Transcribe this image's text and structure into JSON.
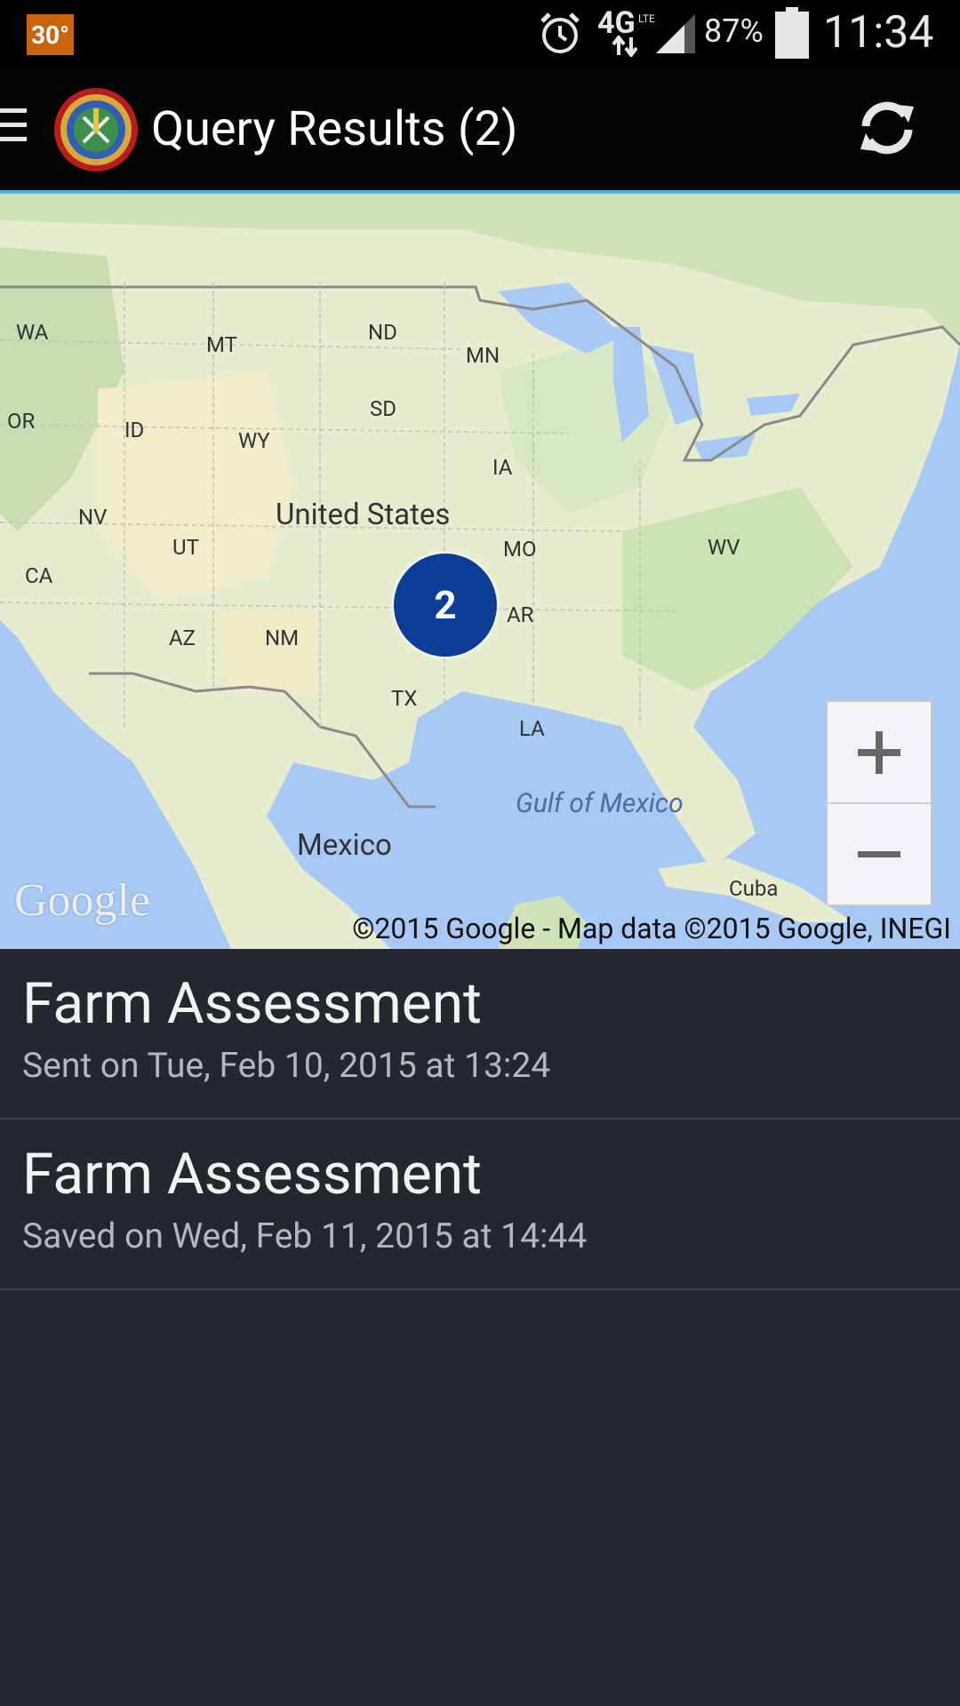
{
  "status_bar": {
    "temperature": "30°",
    "network": "4G",
    "network_sub": "LTE",
    "battery": "87%",
    "time": "11:34"
  },
  "action_bar": {
    "title": "Query Results (2)"
  },
  "map": {
    "labels": {
      "wa": "WA",
      "mt": "MT",
      "nd": "ND",
      "mn": "MN",
      "or": "OR",
      "id": "ID",
      "sd": "SD",
      "wy": "WY",
      "ia": "IA",
      "nv": "NV",
      "ut": "UT",
      "ca": "CA",
      "mo": "MO",
      "wv": "WV",
      "ar": "AR",
      "az": "AZ",
      "nm": "NM",
      "tx": "TX",
      "la": "LA",
      "us": "United States",
      "mexico": "Mexico",
      "cuba": "Cuba",
      "gulf": "Gulf of Mexico"
    },
    "cluster_count": "2",
    "attribution": "©2015 Google - Map data ©2015 Google, INEGI",
    "logo_text": "Google"
  },
  "results": [
    {
      "title": "Farm Assessment",
      "subtitle": "Sent on Tue, Feb 10, 2015 at 13:24"
    },
    {
      "title": "Farm Assessment",
      "subtitle": "Saved on Wed, Feb 11, 2015 at 14:44"
    }
  ],
  "colors": {
    "accent": "#4ab4e6",
    "cluster": "#0d3e97",
    "temp_badge": "#c8630e",
    "list_bg": "#23272f"
  }
}
